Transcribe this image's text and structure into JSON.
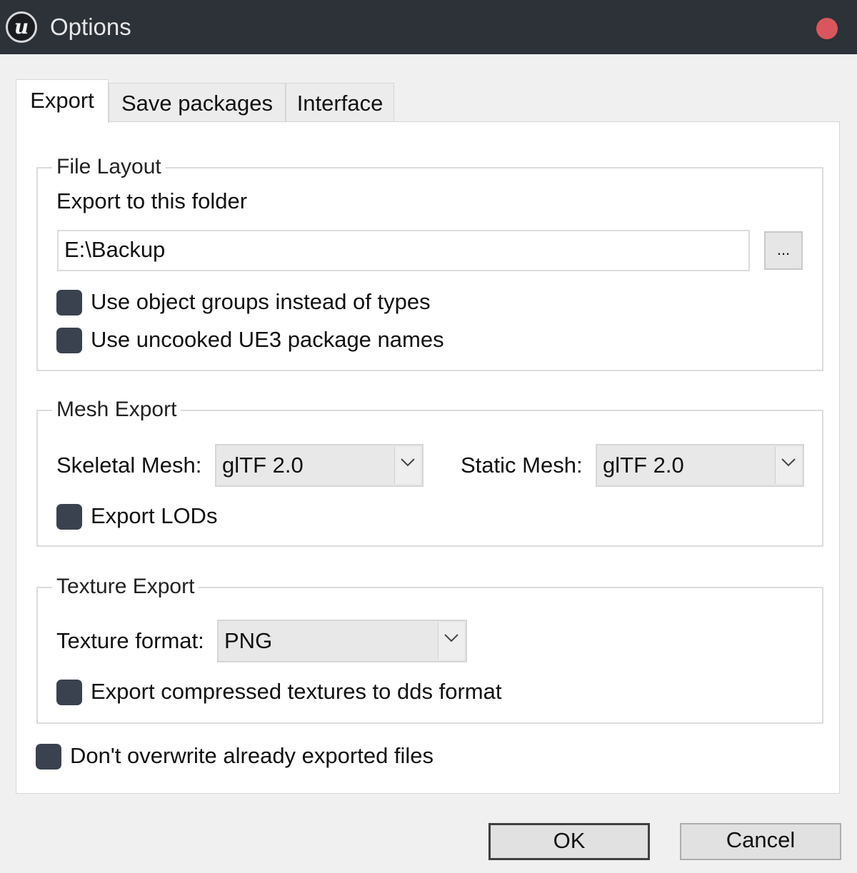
{
  "window": {
    "title": "Options",
    "app_icon": "unreal-engine-logo",
    "app_icon_glyph": "u",
    "close_color": "#d9575c"
  },
  "tabs": [
    {
      "label": "Export",
      "active": true
    },
    {
      "label": "Save packages",
      "active": false
    },
    {
      "label": "Interface",
      "active": false
    }
  ],
  "file_layout": {
    "title": "File Layout",
    "folder_label": "Export to this folder",
    "folder_value": "E:\\Backup",
    "browse_label": "...",
    "use_object_groups": {
      "label": "Use object groups instead of types",
      "checked": false
    },
    "use_uncooked_names": {
      "label": "Use uncooked UE3 package names",
      "checked": false
    }
  },
  "mesh_export": {
    "title": "Mesh Export",
    "skeletal_label": "Skeletal Mesh:",
    "skeletal_value": "glTF 2.0",
    "static_label": "Static Mesh:",
    "static_value": "glTF 2.0",
    "export_lods": {
      "label": "Export LODs",
      "checked": false
    }
  },
  "texture_export": {
    "title": "Texture Export",
    "format_label": "Texture format:",
    "format_value": "PNG",
    "export_dds": {
      "label": "Export compressed textures to dds format",
      "checked": false
    }
  },
  "dont_overwrite": {
    "label": "Don't overwrite already exported files",
    "checked": false
  },
  "buttons": {
    "ok": "OK",
    "cancel": "Cancel"
  },
  "colors": {
    "titlebar": "#2d3138",
    "checkbox": "#3a4250"
  }
}
